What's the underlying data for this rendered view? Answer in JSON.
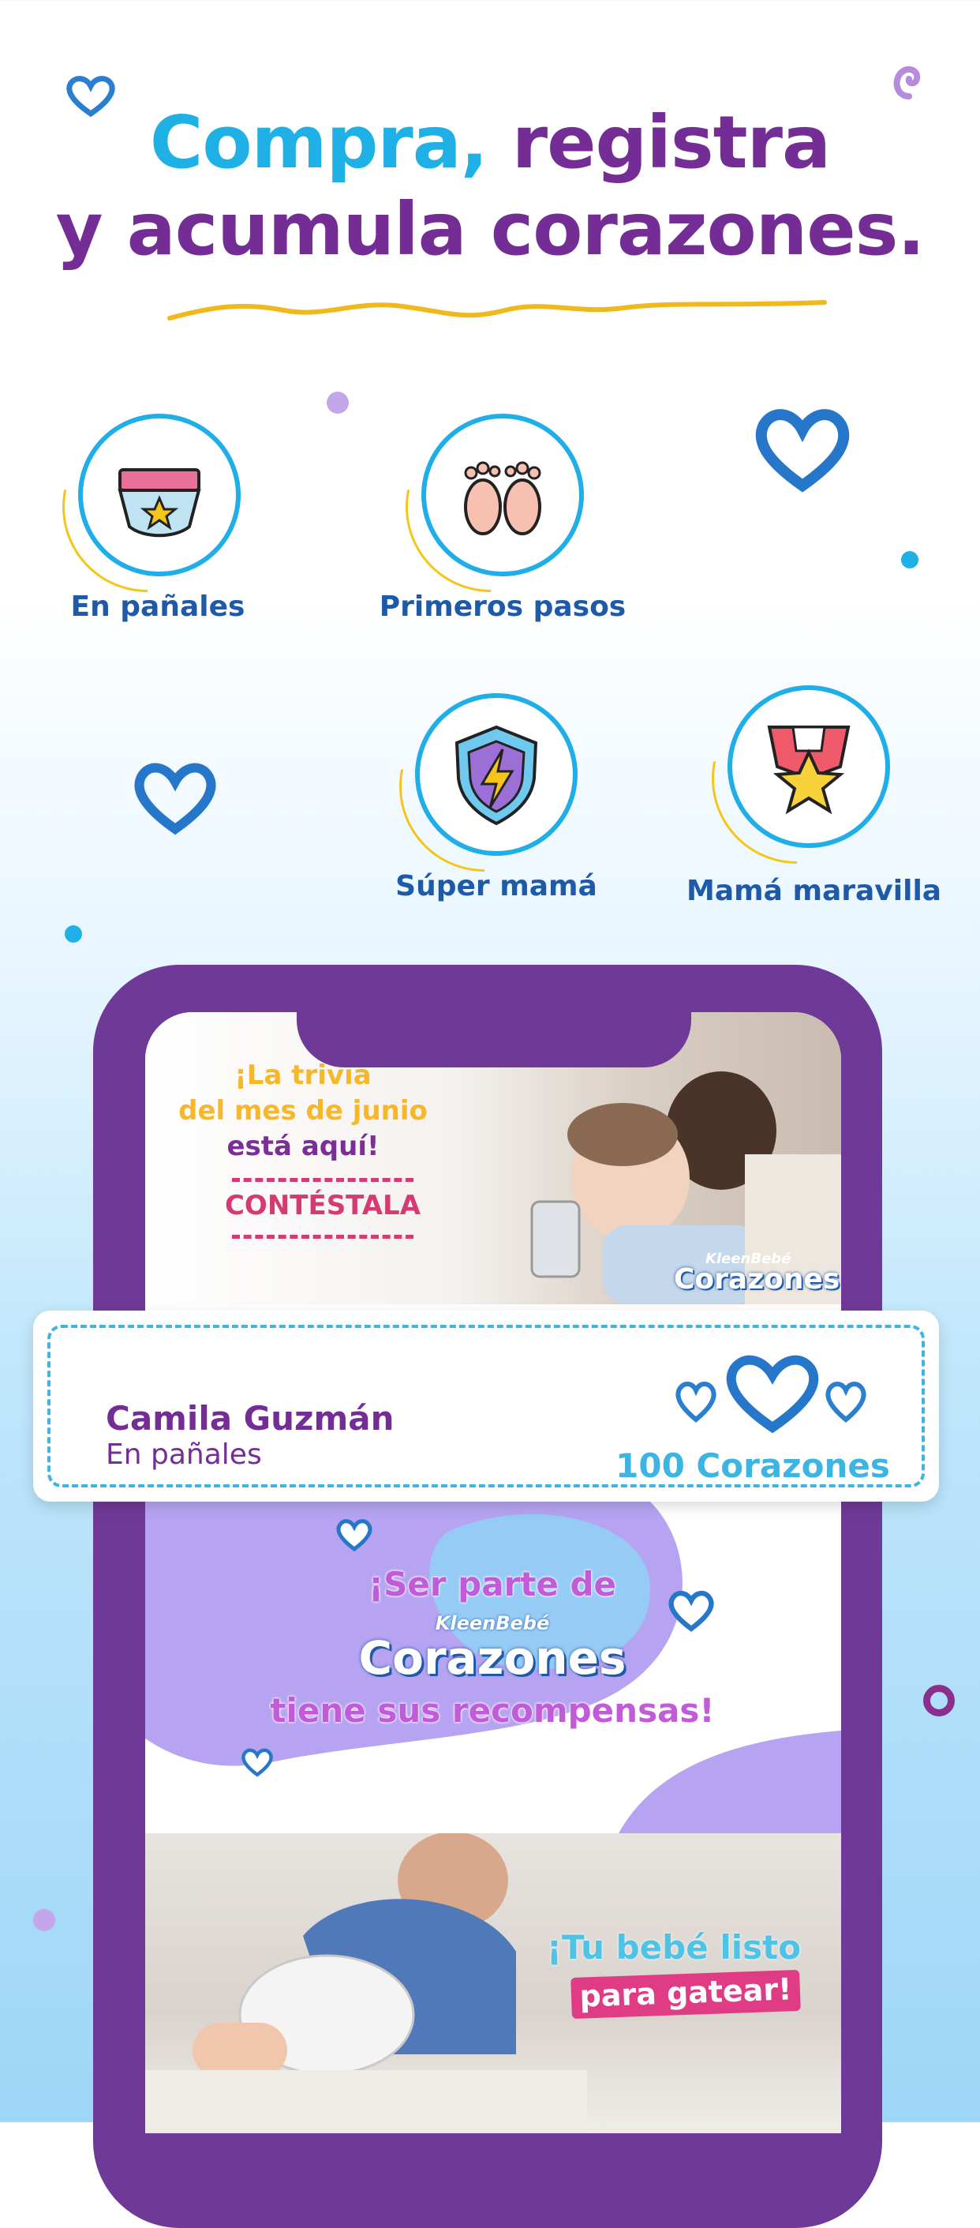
{
  "headline": {
    "part1": "Compra,",
    "part2": "registra",
    "line2": "y acumula corazones."
  },
  "levels": [
    {
      "label": "En pañales",
      "icon": "diaper-icon"
    },
    {
      "label": "Primeros pasos",
      "icon": "baby-feet-icon"
    },
    {
      "label": "Súper mamá",
      "icon": "lightning-shield-icon"
    },
    {
      "label": "Mamá maravilla",
      "icon": "star-medal-icon"
    }
  ],
  "phone_banners": {
    "trivia": {
      "line1": "¡La trivia",
      "line2": "del mes de junio",
      "line3": "está aquí!",
      "cta": "CONTÉSTALA",
      "brand_small": "KleenBebé",
      "brand_big": "Corazones"
    },
    "rewards": {
      "line1": "¡Ser parte de",
      "brand_small": "KleenBebé",
      "brand_big": "Corazones",
      "line2": "tiene sus recompensas!"
    },
    "crawl": {
      "line1": "¡Tu bebé listo",
      "line2": "para gatear!"
    }
  },
  "user_card": {
    "name": "Camila Guzmán",
    "level": "En pañales",
    "hearts": "100 Corazones"
  },
  "colors": {
    "blue": "#1fb0e6",
    "purple": "#742d95",
    "phone": "#6f3a97",
    "yellow": "#f5c51a"
  }
}
